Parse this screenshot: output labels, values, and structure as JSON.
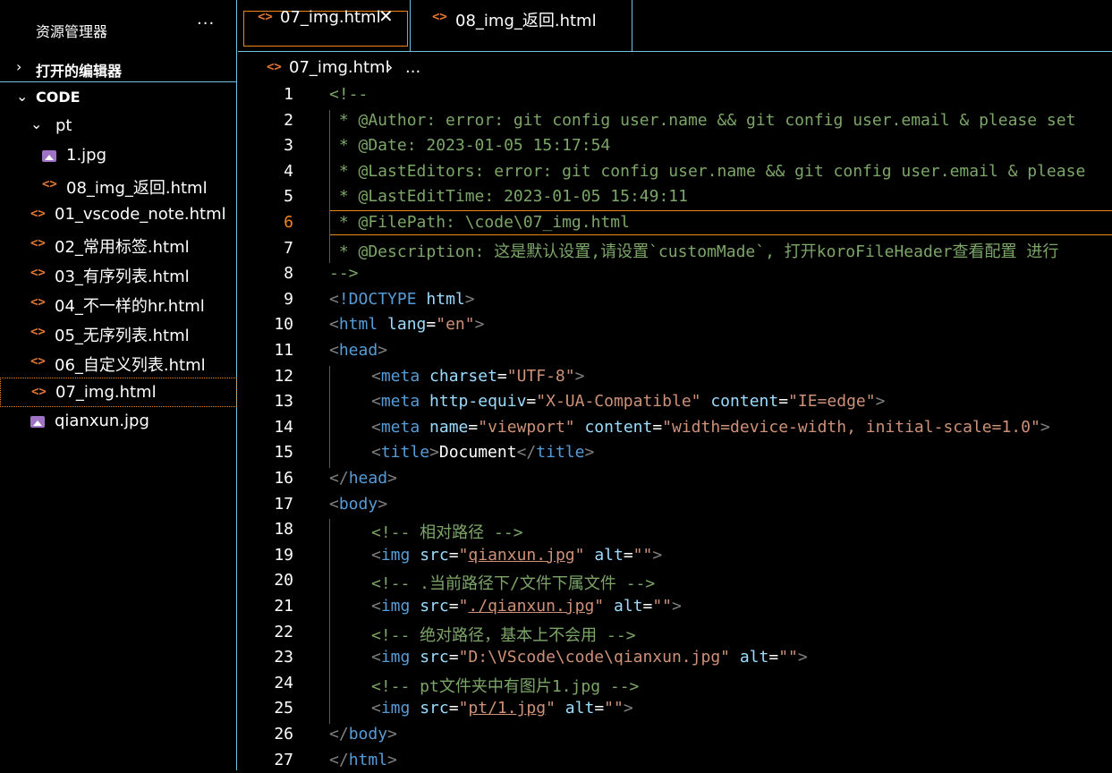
{
  "sidebar": {
    "title": "资源管理器",
    "more": "···",
    "open_editors_label": "打开的编辑器",
    "workspace_label": "CODE",
    "tree": [
      {
        "label": "pt",
        "type": "folder",
        "depth": 1
      },
      {
        "label": "1.jpg",
        "type": "image",
        "depth": 2
      },
      {
        "label": "08_img_返回.html",
        "type": "html",
        "depth": 2
      },
      {
        "label": "01_vscode_note.html",
        "type": "html",
        "depth": 1
      },
      {
        "label": "02_常用标签.html",
        "type": "html",
        "depth": 1
      },
      {
        "label": "03_有序列表.html",
        "type": "html",
        "depth": 1
      },
      {
        "label": "04_不一样的hr.html",
        "type": "html",
        "depth": 1
      },
      {
        "label": "05_无序列表.html",
        "type": "html",
        "depth": 1
      },
      {
        "label": "06_自定义列表.html",
        "type": "html",
        "depth": 1
      },
      {
        "label": "07_img.html",
        "type": "html",
        "depth": 1,
        "selected": true
      },
      {
        "label": "qianxun.jpg",
        "type": "image",
        "depth": 1
      }
    ]
  },
  "tabs": [
    {
      "label": "07_img.html",
      "active": true,
      "close": "✕"
    },
    {
      "label": "08_img_返回.html",
      "active": false
    }
  ],
  "breadcrumb": {
    "file": "07_img.html",
    "separator": "›",
    "more": "..."
  },
  "colors": {
    "accent_border": "#6fc3df",
    "active_border": "#f38518",
    "comment": "#7ca668",
    "tag": "#569cd6",
    "attr": "#9cdcfe",
    "string": "#ce9178",
    "html_icon": "#e37933",
    "image_icon": "#a074c4"
  },
  "editor": {
    "current_line": 6,
    "lines": [
      {
        "n": "1",
        "indent": 0,
        "tokens": [
          [
            "c-com",
            "<!--"
          ]
        ]
      },
      {
        "n": "2",
        "indent": 0,
        "tokens": [
          [
            "c-com",
            " * @Author: error: git config user.name && git config user.email & please set"
          ]
        ]
      },
      {
        "n": "3",
        "indent": 0,
        "tokens": [
          [
            "c-com",
            " * @Date: 2023-01-05 15:17:54"
          ]
        ]
      },
      {
        "n": "4",
        "indent": 0,
        "tokens": [
          [
            "c-com",
            " * @LastEditors: error: git config user.name && git config user.email & please"
          ]
        ]
      },
      {
        "n": "5",
        "indent": 0,
        "tokens": [
          [
            "c-com",
            " * @LastEditTime: 2023-01-05 15:49:11"
          ]
        ]
      },
      {
        "n": "6",
        "indent": 0,
        "tokens": [
          [
            "c-com",
            " * @FilePath: \\code\\07_img.html"
          ]
        ]
      },
      {
        "n": "7",
        "indent": 0,
        "tokens": [
          [
            "c-com",
            " * @Description: 这是默认设置,请设置`customMade`, 打开koroFileHeader查看配置 进行"
          ]
        ]
      },
      {
        "n": "8",
        "indent": 0,
        "tokens": [
          [
            "c-com",
            "-->"
          ]
        ]
      },
      {
        "n": "9",
        "indent": 0,
        "tokens": [
          [
            "c-br",
            "<"
          ],
          [
            "c-tag",
            "!DOCTYPE"
          ],
          [
            "c-txt",
            " "
          ],
          [
            "c-attr",
            "html"
          ],
          [
            "c-br",
            ">"
          ]
        ]
      },
      {
        "n": "10",
        "indent": 0,
        "tokens": [
          [
            "c-br",
            "<"
          ],
          [
            "c-tag",
            "html"
          ],
          [
            "c-txt",
            " "
          ],
          [
            "c-attr",
            "lang"
          ],
          [
            "c-txt",
            "="
          ],
          [
            "c-str",
            "\"en\""
          ],
          [
            "c-br",
            ">"
          ]
        ]
      },
      {
        "n": "11",
        "indent": 0,
        "tokens": [
          [
            "c-br",
            "<"
          ],
          [
            "c-tag",
            "head"
          ],
          [
            "c-br",
            ">"
          ]
        ]
      },
      {
        "n": "12",
        "indent": 1,
        "tokens": [
          [
            "c-br",
            "<"
          ],
          [
            "c-tag",
            "meta"
          ],
          [
            "c-txt",
            " "
          ],
          [
            "c-attr",
            "charset"
          ],
          [
            "c-txt",
            "="
          ],
          [
            "c-str",
            "\"UTF-8\""
          ],
          [
            "c-br",
            ">"
          ]
        ]
      },
      {
        "n": "13",
        "indent": 1,
        "tokens": [
          [
            "c-br",
            "<"
          ],
          [
            "c-tag",
            "meta"
          ],
          [
            "c-txt",
            " "
          ],
          [
            "c-attr",
            "http-equiv"
          ],
          [
            "c-txt",
            "="
          ],
          [
            "c-str",
            "\"X-UA-Compatible\""
          ],
          [
            "c-txt",
            " "
          ],
          [
            "c-attr",
            "content"
          ],
          [
            "c-txt",
            "="
          ],
          [
            "c-str",
            "\"IE=edge\""
          ],
          [
            "c-br",
            ">"
          ]
        ]
      },
      {
        "n": "14",
        "indent": 1,
        "tokens": [
          [
            "c-br",
            "<"
          ],
          [
            "c-tag",
            "meta"
          ],
          [
            "c-txt",
            " "
          ],
          [
            "c-attr",
            "name"
          ],
          [
            "c-txt",
            "="
          ],
          [
            "c-str",
            "\"viewport\""
          ],
          [
            "c-txt",
            " "
          ],
          [
            "c-attr",
            "content"
          ],
          [
            "c-txt",
            "="
          ],
          [
            "c-str",
            "\"width=device-width, initial-scale=1.0\""
          ],
          [
            "c-br",
            ">"
          ]
        ]
      },
      {
        "n": "15",
        "indent": 1,
        "tokens": [
          [
            "c-br",
            "<"
          ],
          [
            "c-tag",
            "title"
          ],
          [
            "c-br",
            ">"
          ],
          [
            "c-txt",
            "Document"
          ],
          [
            "c-br",
            "</"
          ],
          [
            "c-tag",
            "title"
          ],
          [
            "c-br",
            ">"
          ]
        ]
      },
      {
        "n": "16",
        "indent": 0,
        "tokens": [
          [
            "c-br",
            "</"
          ],
          [
            "c-tag",
            "head"
          ],
          [
            "c-br",
            ">"
          ]
        ]
      },
      {
        "n": "17",
        "indent": 0,
        "tokens": [
          [
            "c-br",
            "<"
          ],
          [
            "c-tag",
            "body"
          ],
          [
            "c-br",
            ">"
          ]
        ]
      },
      {
        "n": "18",
        "indent": 1,
        "tokens": [
          [
            "c-com",
            "<!-- 相对路径 -->"
          ]
        ]
      },
      {
        "n": "19",
        "indent": 1,
        "tokens": [
          [
            "c-br",
            "<"
          ],
          [
            "c-tag",
            "img"
          ],
          [
            "c-txt",
            " "
          ],
          [
            "c-attr",
            "src"
          ],
          [
            "c-txt",
            "="
          ],
          [
            "c-str",
            "\""
          ],
          [
            "c-link",
            "qianxun.jpg"
          ],
          [
            "c-str",
            "\""
          ],
          [
            "c-txt",
            " "
          ],
          [
            "c-attr",
            "alt"
          ],
          [
            "c-txt",
            "="
          ],
          [
            "c-str",
            "\"\""
          ],
          [
            "c-br",
            ">"
          ]
        ]
      },
      {
        "n": "20",
        "indent": 1,
        "tokens": [
          [
            "c-com",
            "<!-- .当前路径下/文件下属文件 -->"
          ]
        ]
      },
      {
        "n": "21",
        "indent": 1,
        "tokens": [
          [
            "c-br",
            "<"
          ],
          [
            "c-tag",
            "img"
          ],
          [
            "c-txt",
            " "
          ],
          [
            "c-attr",
            "src"
          ],
          [
            "c-txt",
            "="
          ],
          [
            "c-str",
            "\""
          ],
          [
            "c-link",
            "./qianxun.jpg"
          ],
          [
            "c-str",
            "\""
          ],
          [
            "c-txt",
            " "
          ],
          [
            "c-attr",
            "alt"
          ],
          [
            "c-txt",
            "="
          ],
          [
            "c-str",
            "\"\""
          ],
          [
            "c-br",
            ">"
          ]
        ]
      },
      {
        "n": "22",
        "indent": 1,
        "tokens": [
          [
            "c-com",
            "<!-- 绝对路径，基本上不会用 -->"
          ]
        ]
      },
      {
        "n": "23",
        "indent": 1,
        "tokens": [
          [
            "c-br",
            "<"
          ],
          [
            "c-tag",
            "img"
          ],
          [
            "c-txt",
            " "
          ],
          [
            "c-attr",
            "src"
          ],
          [
            "c-txt",
            "="
          ],
          [
            "c-str",
            "\"D:\\VScode\\code\\qianxun.jpg\""
          ],
          [
            "c-txt",
            " "
          ],
          [
            "c-attr",
            "alt"
          ],
          [
            "c-txt",
            "="
          ],
          [
            "c-str",
            "\"\""
          ],
          [
            "c-br",
            ">"
          ]
        ]
      },
      {
        "n": "24",
        "indent": 1,
        "tokens": [
          [
            "c-com",
            "<!-- pt文件夹中有图片1.jpg -->"
          ]
        ]
      },
      {
        "n": "25",
        "indent": 1,
        "tokens": [
          [
            "c-br",
            "<"
          ],
          [
            "c-tag",
            "img"
          ],
          [
            "c-txt",
            " "
          ],
          [
            "c-attr",
            "src"
          ],
          [
            "c-txt",
            "="
          ],
          [
            "c-str",
            "\""
          ],
          [
            "c-link",
            "pt/1.jpg"
          ],
          [
            "c-str",
            "\""
          ],
          [
            "c-txt",
            " "
          ],
          [
            "c-attr",
            "alt"
          ],
          [
            "c-txt",
            "="
          ],
          [
            "c-str",
            "\"\""
          ],
          [
            "c-br",
            ">"
          ]
        ]
      },
      {
        "n": "26",
        "indent": 0,
        "tokens": [
          [
            "c-br",
            "</"
          ],
          [
            "c-tag",
            "body"
          ],
          [
            "c-br",
            ">"
          ]
        ]
      },
      {
        "n": "27",
        "indent": 0,
        "tokens": [
          [
            "c-br",
            "</"
          ],
          [
            "c-tag",
            "html"
          ],
          [
            "c-br",
            ">"
          ]
        ]
      }
    ]
  }
}
